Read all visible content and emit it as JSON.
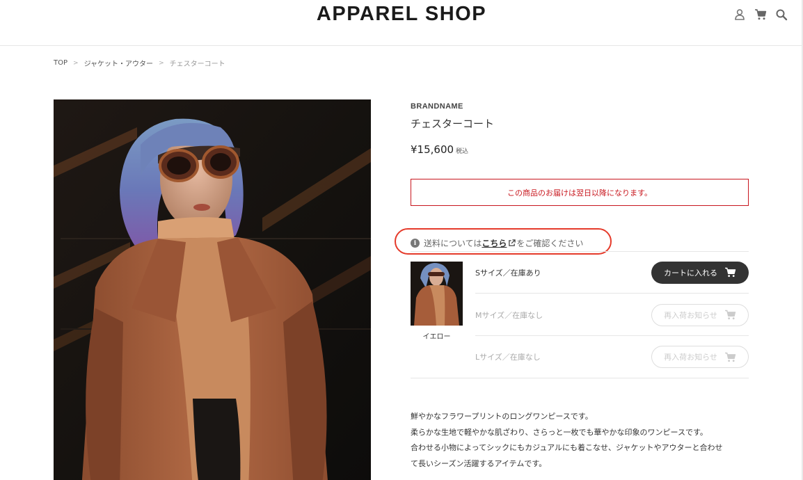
{
  "header": {
    "logo": "APPAREL SHOP",
    "icons": [
      "user-icon",
      "cart-icon",
      "search-icon"
    ]
  },
  "breadcrumb": {
    "items": [
      "TOP",
      "ジャケット・アウター",
      "チェスターコート"
    ],
    "separator": ">"
  },
  "product": {
    "brand": "BRANDNAME",
    "name": "チェスターコート",
    "price": "¥15,600",
    "tax_label": "税込",
    "notice": "この商品のお届けは翌日以降になります。"
  },
  "shipping": {
    "prefix": "送料については",
    "link": "こちら",
    "suffix": "をご確認ください"
  },
  "variant": {
    "color": "イエロー",
    "rows": [
      {
        "label": "Sサイズ／在庫あり",
        "button": "カートに入れる",
        "available": true
      },
      {
        "label": "Mサイズ／在庫なし",
        "button": "再入荷お知らせ",
        "available": false
      },
      {
        "label": "Lサイズ／在庫なし",
        "button": "再入荷お知らせ",
        "available": false
      }
    ]
  },
  "description": [
    "鮮やかなフラワープリントのロングワンピースです。",
    "柔らかな生地で軽やかな肌ざわり、さらっと一枚でも華やかな印象のワンピースです。",
    "合わせる小物によってシックにもカジュアルにも着こなせ、ジャケットやアウターと合わせ",
    "て長いシーズン活躍するアイテムです。"
  ],
  "colors": {
    "notice_red": "#c8161d",
    "annotation_red": "#e53a2a",
    "cart_button": "#333333"
  }
}
